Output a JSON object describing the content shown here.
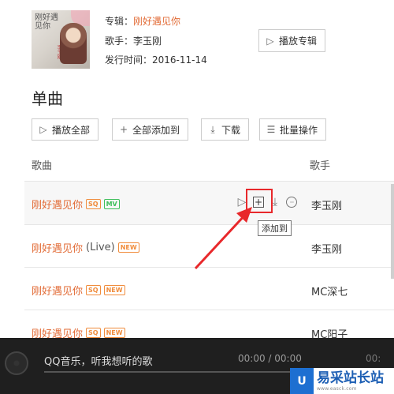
{
  "album": {
    "cover_title": "刚好遇见你",
    "cover_sign": "李玉刚",
    "album_label": "专辑：",
    "album_name": "刚好遇见你",
    "singer_label": "歌手：",
    "singer_name": "李玉刚",
    "date_label": "发行时间：",
    "date_value": "2016-11-14",
    "play_button": "播放专辑"
  },
  "section": {
    "title": "单曲"
  },
  "toolbar": {
    "play_all": "播放全部",
    "add_all": "全部添加到",
    "download": "下载",
    "batch": "批量操作"
  },
  "columns": {
    "song": "歌曲",
    "singer": "歌手"
  },
  "songs": [
    {
      "title": "刚好遇见你",
      "subtitle": "",
      "tags": [
        "SQ",
        "MV"
      ],
      "singer": "李玉刚"
    },
    {
      "title": "刚好遇见你",
      "subtitle": "(Live)",
      "tags": [
        "NEW"
      ],
      "singer": "李玉刚"
    },
    {
      "title": "刚好遇见你",
      "subtitle": "",
      "tags": [
        "SQ",
        "NEW"
      ],
      "singer": "MC深七"
    },
    {
      "title": "刚好遇见你",
      "subtitle": "",
      "tags": [
        "SQ",
        "NEW"
      ],
      "singer": "MC阳子"
    }
  ],
  "tooltip": "添加到",
  "player": {
    "slogan": "QQ音乐，听我想听的歌",
    "time": "00:00 / 00:00",
    "time_right": "00:"
  },
  "watermark": {
    "logo": "U",
    "name": "易采站长站",
    "url": "www.easck.com"
  },
  "colors": {
    "accent": "#e26b36",
    "highlight": "#e8282b",
    "mv_tag": "#3cbf5a",
    "player_bg": "#1f1f1f"
  }
}
